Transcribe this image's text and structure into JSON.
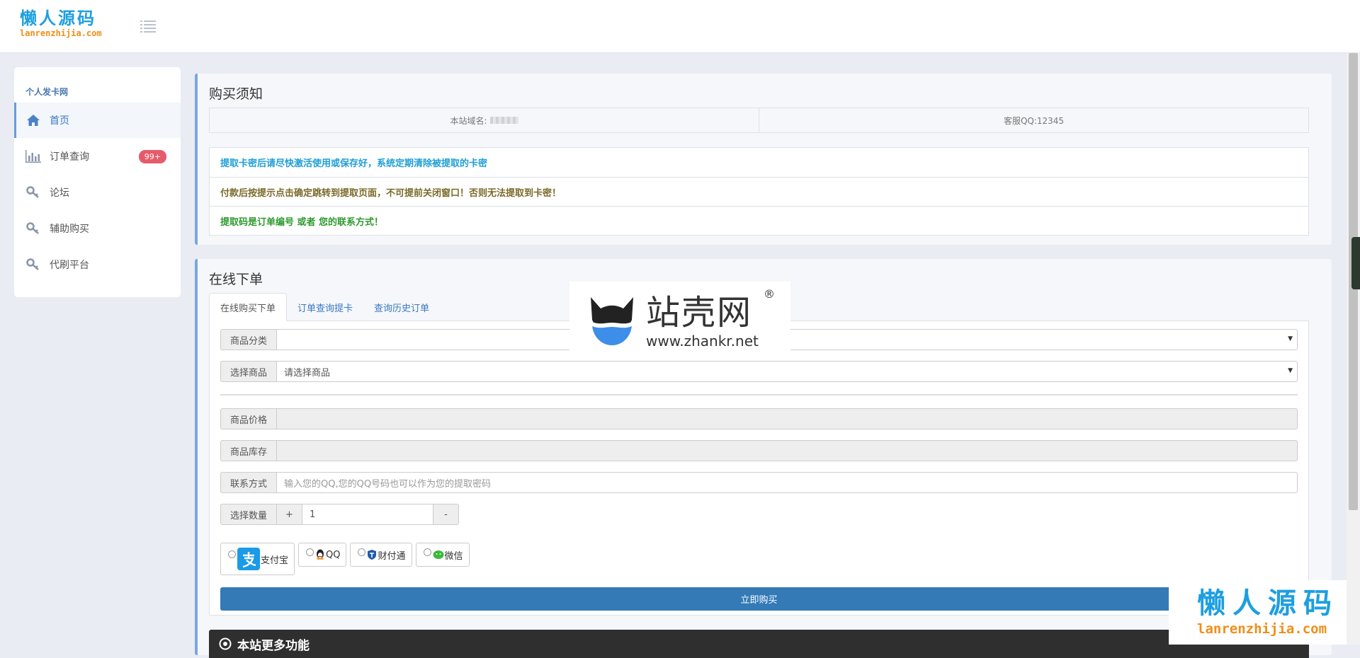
{
  "header": {
    "logo_cn": "懒人源码",
    "logo_en": "lanrenzhijia.com",
    "menu_icon": "list-icon"
  },
  "sidebar": {
    "title": "个人发卡网",
    "items": [
      {
        "label": "首页",
        "icon": "home-icon"
      },
      {
        "label": "订单查询",
        "icon": "bar-chart-icon",
        "badge": "99+"
      },
      {
        "label": "论坛",
        "icon": "key-icon"
      },
      {
        "label": "辅助购买",
        "icon": "key-icon"
      },
      {
        "label": "代刷平台",
        "icon": "key-icon"
      }
    ]
  },
  "notice": {
    "title": "购买须知",
    "domain_label": "本站域名:",
    "service_qq": "客服QQ:12345",
    "lines": [
      {
        "text": "提取卡密后请尽快激活使用或保存好，系统定期清除被提取的卡密",
        "color": "#1e9fd6"
      },
      {
        "text": "付款后按提示点击确定跳转到提取页面，不可提前关闭窗口！否则无法提取到卡密！",
        "color": "#7a6a2a"
      },
      {
        "text": "提取码是订单编号 或者 您的联系方式！",
        "color": "#2e9a2e"
      }
    ]
  },
  "order": {
    "title": "在线下单",
    "tabs": [
      "在线购买下单",
      "订单查询提卡",
      "查询历史订单"
    ],
    "fields": {
      "category_label": "商品分类",
      "category_value": "",
      "product_label": "选择商品",
      "product_value": "请选择商品",
      "price_label": "商品价格",
      "stock_label": "商品库存",
      "contact_label": "联系方式",
      "contact_placeholder": "输入您的QQ,您的QQ号码也可以作为您的提取密码",
      "qty_label": "选择数量",
      "qty_plus": "+",
      "qty_value": "1",
      "qty_minus": "-"
    },
    "payments": [
      {
        "label": "支付宝",
        "icon": "alipay-icon"
      },
      {
        "label": "QQ",
        "icon": "qq-penguin-icon"
      },
      {
        "label": "财付通",
        "icon": "tenpay-shield-icon"
      },
      {
        "label": "微信",
        "icon": "wechat-icon"
      }
    ],
    "buy_label": "立即购买",
    "more_label": "本站更多功能"
  },
  "watermarks": {
    "center_cn": "站壳网",
    "center_reg": "®",
    "center_en": "www.zhankr.net",
    "corner_cn": "懒人源码",
    "corner_en": "lanrenzhijia.com"
  },
  "colors": {
    "brand_blue": "#1e9fe0",
    "brand_orange": "#f08e18",
    "primary_button": "#337ab7",
    "badge_red": "#e65b6b",
    "panel_accent": "#7ba6df"
  }
}
